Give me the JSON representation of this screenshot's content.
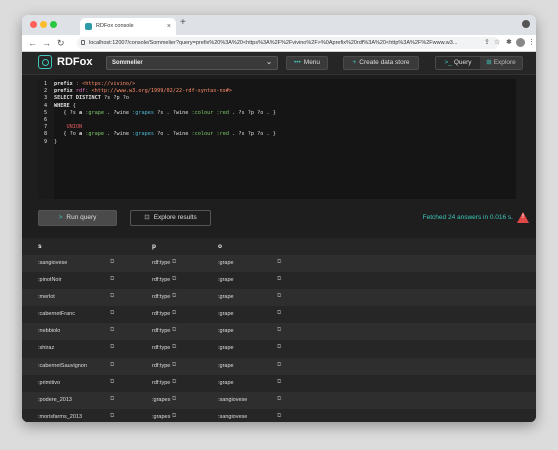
{
  "browser": {
    "tab_title": "RDFox console",
    "tab_close": "×",
    "new_tab": "+",
    "url": "localhost:12007/console/Sommelier?query=prefix%20%3A%20<https%3A%2F%2Fvivino%2F>%0Aprefix%20rdf%3A%20<http%3A%2F%2Fwww.w3..."
  },
  "header": {
    "brand": "RDFox",
    "datastore": "Sommelier",
    "menu_label": "Menu",
    "create_label": "Create data store",
    "query_label": "Query",
    "explore_label": "Explore"
  },
  "editor": {
    "lines": [
      "prefix : <https://vivino/>",
      "prefix rdf: <http://www.w3.org/1999/02/22-rdf-syntax-ns#>",
      "SELECT DISTINCT ?s ?p ?o",
      "WHERE {",
      "{ ?s a :grape . ?wine :grapes ?s . ?wine :colour :red . ?s ?p ?o . }",
      "",
      "UNION",
      "{ ?o a :grape . ?wine :grapes ?o . ?wine :colour :red . ?s ?p ?o . }",
      "}"
    ]
  },
  "actions": {
    "run_label": "Run query",
    "explore_label": "Explore results",
    "status": "Fetched 24 answers in 0.016 s."
  },
  "results": {
    "columns": [
      "s",
      "p",
      "o"
    ],
    "rows": [
      [
        ":sangiovese",
        "rdf:type",
        ":grape"
      ],
      [
        ":pinotNoir",
        "rdf:type",
        ":grape"
      ],
      [
        ":merlot",
        "rdf:type",
        ":grape"
      ],
      [
        ":cabernetFranc",
        "rdf:type",
        ":grape"
      ],
      [
        ":nebbiolo",
        "rdf:type",
        ":grape"
      ],
      [
        ":shiraz",
        "rdf:type",
        ":grape"
      ],
      [
        ":cabernetSauvignon",
        "rdf:type",
        ":grape"
      ],
      [
        ":primitivo",
        "rdf:type",
        ":grape"
      ],
      [
        ":podere_2013",
        ":grapes",
        ":sangiovese"
      ],
      [
        ":morisfarms_2013",
        ":grapes",
        ":sangiovese"
      ]
    ]
  },
  "colors": {
    "accent": "#3ec6bb",
    "warning": "#e04848",
    "background": "#1e1e1e"
  }
}
